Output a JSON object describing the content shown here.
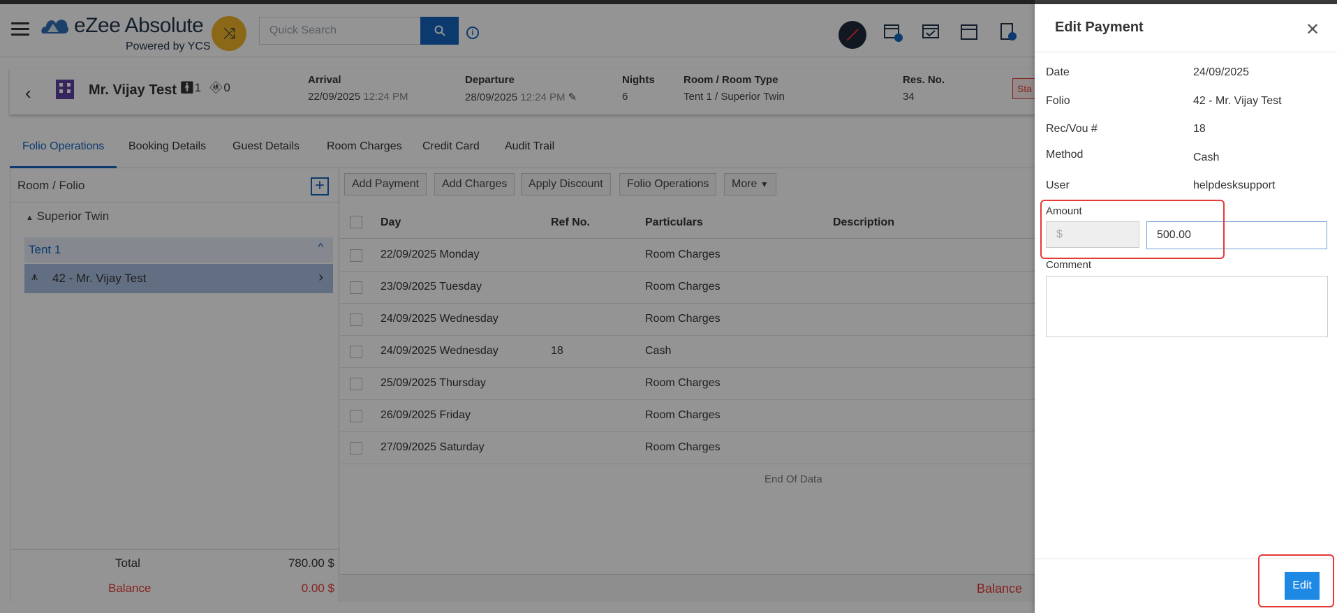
{
  "header": {
    "brand_title": "eZee Absolute",
    "brand_subtitle": "Powered by YCS",
    "search_placeholder": "Quick Search"
  },
  "reservation": {
    "guest_name": "Mr. Vijay Test",
    "adults": "1",
    "children": "0",
    "arrival_label": "Arrival",
    "arrival_date": "22/09/2025",
    "arrival_time": "12:24 PM",
    "departure_label": "Departure",
    "departure_date": "28/09/2025",
    "departure_time": "12:24 PM",
    "nights_label": "Nights",
    "nights": "6",
    "room_label": "Room / Room Type",
    "room_value": "Tent 1 / Superior Twin",
    "resno_label": "Res. No.",
    "resno_value": "34",
    "status_chip": "Sta"
  },
  "tabs": [
    {
      "label": "Folio Operations"
    },
    {
      "label": "Booking Details"
    },
    {
      "label": "Guest Details"
    },
    {
      "label": "Room Charges"
    },
    {
      "label": "Credit Card"
    },
    {
      "label": "Audit Trail"
    }
  ],
  "left_panel": {
    "title": "Room / Folio",
    "group": "Superior Twin",
    "room": "Tent 1",
    "folio": "42 - Mr. Vijay Test",
    "total_label": "Total",
    "total_value": "780.00 $",
    "balance_label": "Balance",
    "balance_value": "0.00 $"
  },
  "toolbar": {
    "add_payment": "Add Payment",
    "add_charges": "Add Charges",
    "apply_discount": "Apply Discount",
    "folio_operations": "Folio Operations",
    "more": "More"
  },
  "grid": {
    "columns": {
      "day": "Day",
      "ref": "Ref No.",
      "particulars": "Particulars",
      "description": "Description"
    },
    "rows": [
      {
        "day": "22/09/2025 Monday",
        "ref": "",
        "particulars": "Room Charges"
      },
      {
        "day": "23/09/2025 Tuesday",
        "ref": "",
        "particulars": "Room Charges"
      },
      {
        "day": "24/09/2025 Wednesday",
        "ref": "",
        "particulars": "Room Charges"
      },
      {
        "day": "24/09/2025 Wednesday",
        "ref": "18",
        "particulars": "Cash"
      },
      {
        "day": "25/09/2025 Thursday",
        "ref": "",
        "particulars": "Room Charges"
      },
      {
        "day": "26/09/2025 Friday",
        "ref": "",
        "particulars": "Room Charges"
      },
      {
        "day": "27/09/2025 Saturday",
        "ref": "",
        "particulars": "Room Charges"
      }
    ],
    "end_of_data": "End Of Data",
    "footer_balance": "Balance"
  },
  "drawer": {
    "title": "Edit Payment",
    "fields": [
      {
        "label": "Date",
        "value": "24/09/2025"
      },
      {
        "label": "Folio",
        "value": "42 - Mr. Vijay Test"
      },
      {
        "label": "Rec/Vou #",
        "value": "18"
      },
      {
        "label": "Method",
        "value": "Cash"
      },
      {
        "label": "User",
        "value": "helpdesksupport"
      }
    ],
    "amount_label": "Amount",
    "currency": "$",
    "amount_value": "500.00",
    "comment_label": "Comment",
    "comment_value": "",
    "edit_label": "Edit"
  },
  "colors": {
    "accent": "#1565c0",
    "balance": "#e53935",
    "edit_button": "#1e88e5",
    "highlight": "#e53935"
  }
}
